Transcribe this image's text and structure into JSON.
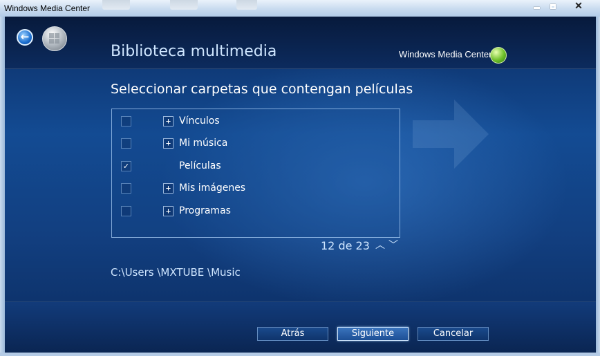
{
  "window": {
    "title": "Windows Media Center"
  },
  "header": {
    "section_title": "Biblioteca multimedia",
    "brand_text_1": "Windows",
    "brand_text_2": "Media Center"
  },
  "main": {
    "heading": "Seleccionar carpetas que contengan películas",
    "folders": [
      {
        "label": "Vínculos",
        "checked": false,
        "expandable": true
      },
      {
        "label": "Mi música",
        "checked": false,
        "expandable": true
      },
      {
        "label": "Películas",
        "checked": true,
        "expandable": false
      },
      {
        "label": "Mis imágenes",
        "checked": false,
        "expandable": true
      },
      {
        "label": "Programas",
        "checked": false,
        "expandable": true
      }
    ],
    "pager": "12 de 23",
    "selected_path": "C:\\Users \\MXTUBE \\Music"
  },
  "buttons": {
    "back": "Atrás",
    "next": "Siguiente",
    "cancel": "Cancelar"
  },
  "glyphs": {
    "check": "✓",
    "expand": "+",
    "up": "︿",
    "down": "﹀",
    "close": "✕"
  }
}
